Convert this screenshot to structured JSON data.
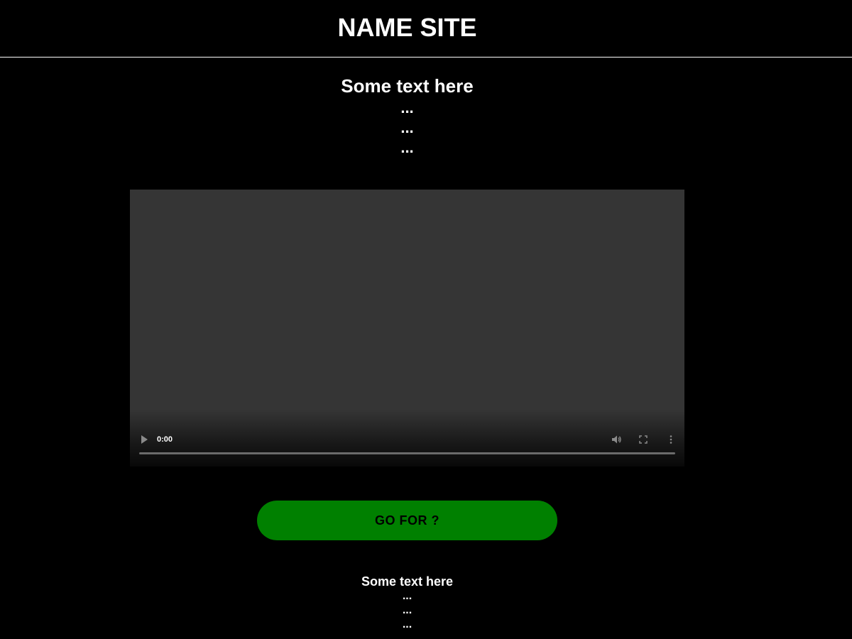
{
  "header": {
    "site_title": "NAME SITE"
  },
  "intro": {
    "title": "Some text here",
    "lines": [
      "...",
      "...",
      "..."
    ]
  },
  "video": {
    "time": "0:00",
    "play_icon": "play-icon",
    "volume_icon": "volume-icon",
    "fullscreen_icon": "fullscreen-icon",
    "more_icon": "more-vertical-icon",
    "progress": 0
  },
  "cta": {
    "label": "GO FOR ?",
    "color": "#008000"
  },
  "outro": {
    "title": "Some text here",
    "lines": [
      "...",
      "...",
      "..."
    ]
  },
  "colors": {
    "background": "#000000",
    "text": "#ffffff",
    "video_bg": "#353535"
  }
}
